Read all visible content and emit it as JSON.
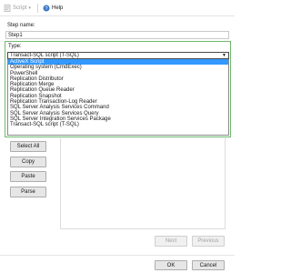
{
  "toolbar": {
    "script_label": "Script",
    "help_label": "Help"
  },
  "step_name": {
    "label": "Step name:",
    "value": "Step1"
  },
  "type": {
    "label": "Type:",
    "selected": "Transact-SQL script (T-SQL)",
    "options": [
      "ActiveX Script",
      "Operating system (CmdExec)",
      "PowerShell",
      "Replication Distributor",
      "Replication Merge",
      "Replication Queue Reader",
      "Replication Snapshot",
      "Replication Transaction-Log Reader",
      "SQL Server Analysis Services Command",
      "SQL Server Analysis Services Query",
      "SQL Server Integration Services Package",
      "Transact-SQL script (T-SQL)"
    ],
    "highlighted_index": 0
  },
  "command_buttons": {
    "select_all": "Select All",
    "copy": "Copy",
    "paste": "Paste",
    "parse": "Parse"
  },
  "nav_buttons": {
    "next": "Next",
    "previous": "Previous"
  },
  "dialog_buttons": {
    "ok": "OK",
    "cancel": "Cancel"
  },
  "colors": {
    "selection": "#3399ff",
    "panel_border": "#6fb86f"
  }
}
